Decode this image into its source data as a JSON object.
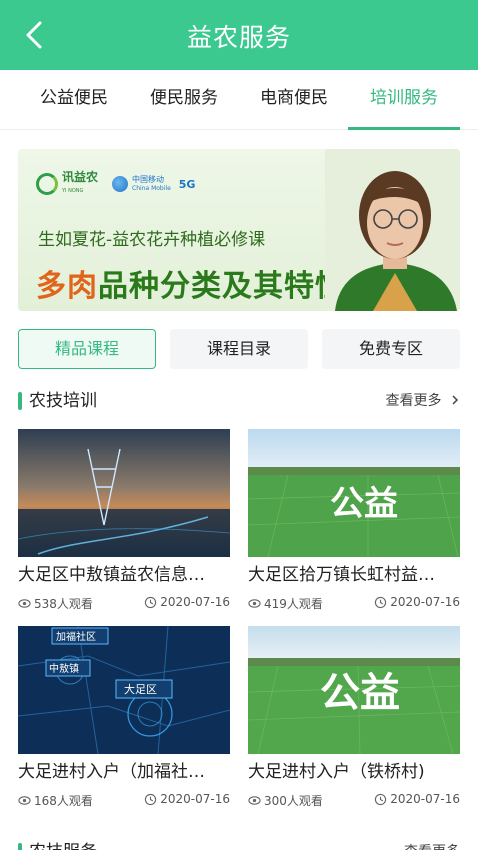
{
  "header": {
    "title": "益农服务"
  },
  "tabs": [
    {
      "label": "公益便民"
    },
    {
      "label": "便民服务"
    },
    {
      "label": "电商便民"
    },
    {
      "label": "培训服务"
    }
  ],
  "active_tab": 3,
  "banner": {
    "brand_name": "益农",
    "brand_name_prefix": "讯",
    "brand_subtitle": "YI NONG",
    "partner_name": "中国移动",
    "partner_subtitle": "China Mobile",
    "network_label": "5G",
    "course_subtitle": "生如夏花-益农花卉种植必修课",
    "headline_highlight": "多肉",
    "headline_rest": "品种分类及其特性"
  },
  "chips": [
    {
      "label": "精品课程"
    },
    {
      "label": "课程目录"
    },
    {
      "label": "免费专区"
    }
  ],
  "section": {
    "title": "农技培训",
    "more_label": "查看更多"
  },
  "videos": [
    {
      "title": "大足区中敖镇益农信息…",
      "views": "538人观看",
      "date": "2020-07-16",
      "thumb_icon": "power-tower-thumbnail"
    },
    {
      "title": "大足区拾万镇长虹村益…",
      "views": "419人观看",
      "date": "2020-07-16",
      "thumb_icon": "farmland-gongyi-thumbnail",
      "overlay_text": "公益"
    },
    {
      "title": "大足进村入户（加福社…",
      "views": "168人观看",
      "date": "2020-07-16",
      "thumb_icon": "digital-map-thumbnail",
      "map_labels": [
        "加福社区",
        "中敖镇",
        "大足区"
      ]
    },
    {
      "title": "大足进村入户（铁桥村)",
      "views": "300人观看",
      "date": "2020-07-16",
      "thumb_icon": "farmland-gongyi-thumbnail",
      "overlay_text": "公益"
    }
  ],
  "next_section": {
    "title": "农技服务",
    "more_label": "查看更多"
  },
  "colors": {
    "brand_green": "#3cc98f",
    "accent_green": "#35b981"
  }
}
